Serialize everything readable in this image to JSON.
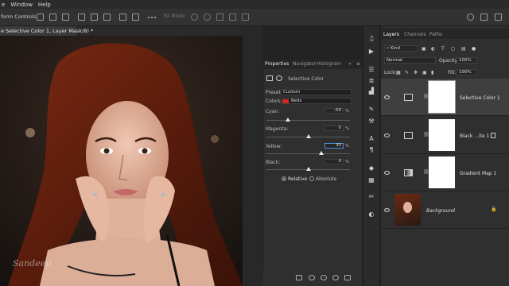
{
  "menu": {
    "items": [
      "e",
      "Window",
      "Help"
    ]
  },
  "options_bar": {
    "transform_label": "form Controls",
    "mode_3d": "3D Mode:"
  },
  "document": {
    "tab_title": "e Selective Color 1, Layer Mask/8) *",
    "watermark": "Sandeep"
  },
  "properties": {
    "tabs": [
      "Properties",
      "Navigator",
      "Histogram"
    ],
    "panel_title": "Selective Color",
    "preset_label": "Preset:",
    "preset_value": "Custom",
    "colors_label": "Colors:",
    "colors_value": "Reds",
    "colors_swatch": "#d42a20",
    "sliders": [
      {
        "label": "Cyan:",
        "value": "-50",
        "level": -50
      },
      {
        "label": "Magenta:",
        "value": "0",
        "level": 0
      },
      {
        "label": "Yellow:",
        "value": "30",
        "level": 30
      },
      {
        "label": "Black:",
        "value": "0",
        "level": 0
      }
    ],
    "percent": "%",
    "method": {
      "relative": "Relative",
      "absolute": "Absolute",
      "selected": "Relative"
    }
  },
  "layers_panel": {
    "tabs": [
      "Layers",
      "Channels",
      "Paths"
    ],
    "filter_kind": "Kind",
    "blend_mode": "Normal",
    "opacity_label": "Opacity:",
    "opacity_value": "100%",
    "lock_label": "Lock:",
    "fill_label": "Fill:",
    "fill_value": "100%",
    "layers": [
      {
        "name": "Selective Color 1",
        "selected": true
      },
      {
        "name": "Black ...ite 1",
        "selected": false
      },
      {
        "name": "Gradient Map 1",
        "selected": false
      },
      {
        "name": "Background",
        "selected": false,
        "locked": true
      }
    ]
  },
  "colors": {
    "accent": "#4a90e2",
    "panel": "#2f2f2f",
    "dark": "#232323"
  }
}
